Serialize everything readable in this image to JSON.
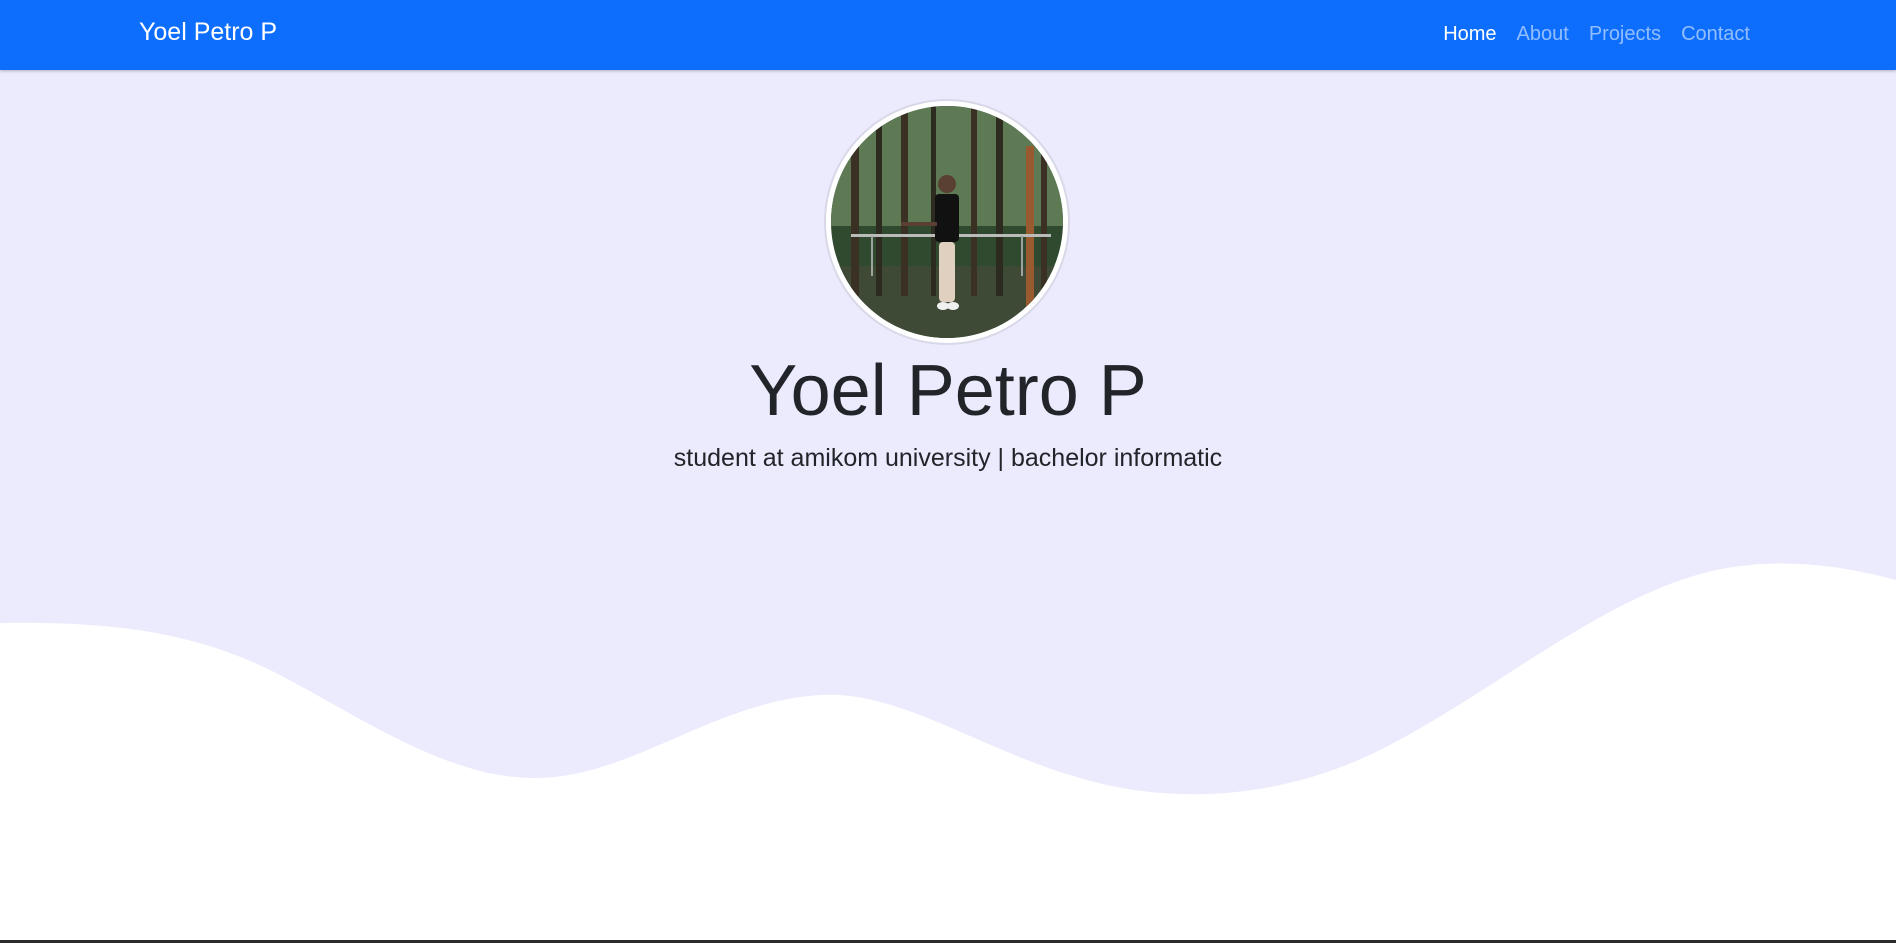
{
  "navbar": {
    "brand": "Yoel Petro P",
    "links": [
      {
        "label": "Home",
        "active": true
      },
      {
        "label": "About",
        "active": false
      },
      {
        "label": "Projects",
        "active": false
      },
      {
        "label": "Contact",
        "active": false
      }
    ],
    "background_color": "#0d6efd"
  },
  "hero": {
    "name": "Yoel Petro P",
    "tagline": "student at amikom university | bachelor informatic",
    "background_color": "#ebebfd",
    "wave_color": "#ffffff",
    "avatar_icon": "profile-photo"
  }
}
